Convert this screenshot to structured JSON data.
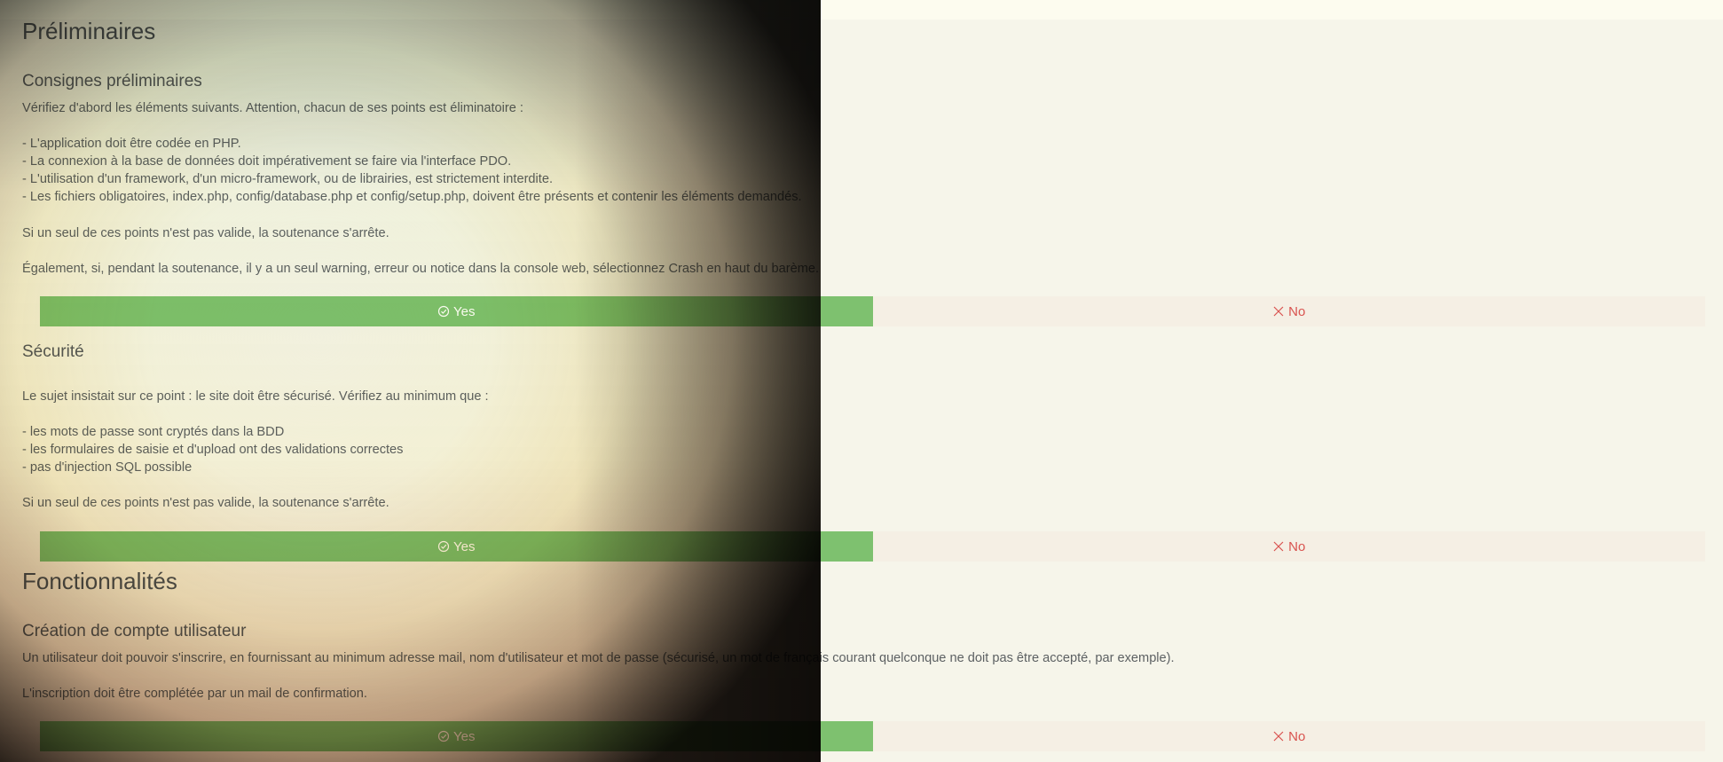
{
  "preliminaires": {
    "title": "Préliminaires",
    "consignes": {
      "title": "Consignes préliminaires",
      "intro": "Vérifiez d'abord les éléments suivants. Attention, chacun de ses points est éliminatoire :",
      "items": [
        "- L'application doit être codée en PHP.",
        "- La connexion à la base de données doit impérativement se faire via l'interface PDO.",
        "- L'utilisation d'un framework, d'un micro-framework, ou de librairies, est strictement interdite.",
        "- Les fichiers obligatoires, index.php, config/database.php et config/setup.php, doivent être présents et contenir les éléments demandés."
      ],
      "stop": "Si un seul de ces points n'est pas valide, la soutenance s'arrête.",
      "crash": "Également, si, pendant la soutenance, il y a un seul warning, erreur ou notice dans la console web, sélectionnez Crash en haut du barème.",
      "yes_label": "Yes",
      "no_label": "No"
    },
    "securite": {
      "title": "Sécurité",
      "intro": "Le sujet insistait sur ce point : le site doit être sécurisé. Vérifiez au minimum que :",
      "items": [
        "- les mots de passe sont cryptés dans la BDD",
        "- les formulaires de saisie et d'upload ont des validations correctes",
        "- pas d'injection SQL possible"
      ],
      "stop": "Si un seul de ces points n'est pas valide, la soutenance s'arrête.",
      "yes_label": "Yes",
      "no_label": "No"
    }
  },
  "fonctionnalites": {
    "title": "Fonctionnalités",
    "creation": {
      "title": "Création de compte utilisateur",
      "line1": "Un utilisateur doit pouvoir s'inscrire, en fournissant au minimum adresse mail, nom d'utilisateur et mot de passe (sécurisé, un mot de français courant quelconque ne doit pas être accepté, par exemple).",
      "line2": "L'inscription doit être complétée par un mail de confirmation.",
      "yes_label": "Yes",
      "no_label": "No"
    }
  },
  "colors": {
    "yes": "#7ec16f",
    "no_bg": "#f5efe4",
    "no_text": "#d9534f",
    "page_bg": "#f6f5ea"
  },
  "icons": {
    "yes": "check-circle-icon",
    "no": "close-icon"
  }
}
